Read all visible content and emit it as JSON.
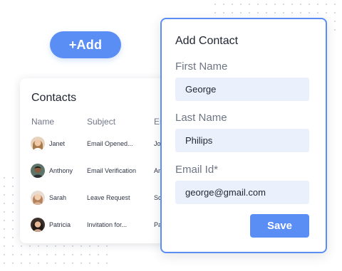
{
  "add_button": {
    "label": "+Add"
  },
  "contacts": {
    "title": "Contacts",
    "columns": [
      "Name",
      "Subject",
      "Em"
    ],
    "rows": [
      {
        "name": "Janet",
        "subject": "Email Opened...",
        "extra": "Jo"
      },
      {
        "name": "Anthony",
        "subject": "Email Verification",
        "extra": "An"
      },
      {
        "name": "Sarah",
        "subject": "Leave Request",
        "extra": "Sc"
      },
      {
        "name": "Patricia",
        "subject": "Invitation for...",
        "extra": "Pa"
      }
    ]
  },
  "form": {
    "title": "Add Contact",
    "first_name": {
      "label": "First Name",
      "value": "George"
    },
    "last_name": {
      "label": "Last Name",
      "value": "Philips"
    },
    "email": {
      "label": "Email Id*",
      "value": "george@gmail.com"
    },
    "save_label": "Save"
  },
  "colors": {
    "accent": "#5b8ef5",
    "input_bg": "#eaf1fd",
    "dots": "#d4d9e2"
  },
  "icons": {
    "avatars": [
      "avatar-photo-janet",
      "avatar-photo-anthony",
      "avatar-photo-sarah",
      "avatar-photo-patricia"
    ]
  }
}
